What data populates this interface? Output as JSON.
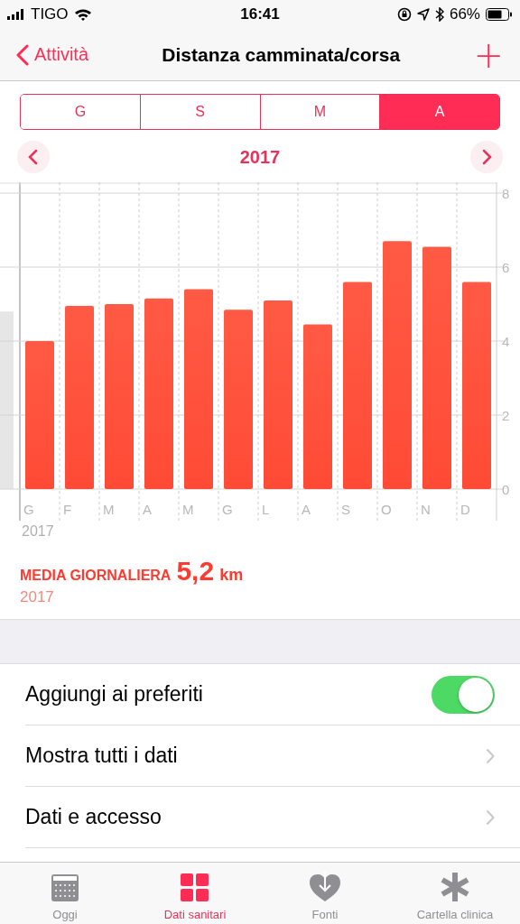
{
  "status_bar": {
    "carrier": "TIGO",
    "time": "16:41",
    "battery": "66%"
  },
  "nav": {
    "back": "Attività",
    "title": "Distanza camminata/corsa",
    "add": "+"
  },
  "segments": [
    {
      "label": "G",
      "selected": false
    },
    {
      "label": "S",
      "selected": false
    },
    {
      "label": "M",
      "selected": false
    },
    {
      "label": "A",
      "selected": true
    }
  ],
  "period": {
    "label": "2017"
  },
  "chart": {
    "year_label": "2017",
    "chart_data": {
      "type": "bar",
      "categories": [
        "G",
        "F",
        "M",
        "A",
        "M",
        "G",
        "L",
        "A",
        "S",
        "O",
        "N",
        "D"
      ],
      "series": [
        {
          "color": "#ff5a45",
          "values": [
            4.0,
            4.95,
            5.0,
            5.15,
            5.4,
            4.85,
            5.1,
            4.45,
            5.6,
            6.7,
            6.55,
            5.6
          ]
        }
      ],
      "ylim": [
        0,
        8
      ],
      "yticks": [
        0,
        2,
        4,
        6,
        8
      ],
      "grid": true
    }
  },
  "summary": {
    "label": "MEDIA GIORNALIERA",
    "value": "5,2",
    "unit": "km",
    "period": "2017"
  },
  "rows": [
    {
      "kind": "toggle",
      "label": "Aggiungi ai preferiti",
      "on": true
    },
    {
      "kind": "link",
      "label": "Mostra tutti i dati"
    },
    {
      "kind": "link",
      "label": "Dati e accesso"
    }
  ],
  "tab_bar": [
    {
      "label": "Oggi",
      "selected": false
    },
    {
      "label": "Dati sanitari",
      "selected": true
    },
    {
      "label": "Fonti",
      "selected": false
    },
    {
      "label": "Cartella clinica",
      "selected": false
    }
  ]
}
